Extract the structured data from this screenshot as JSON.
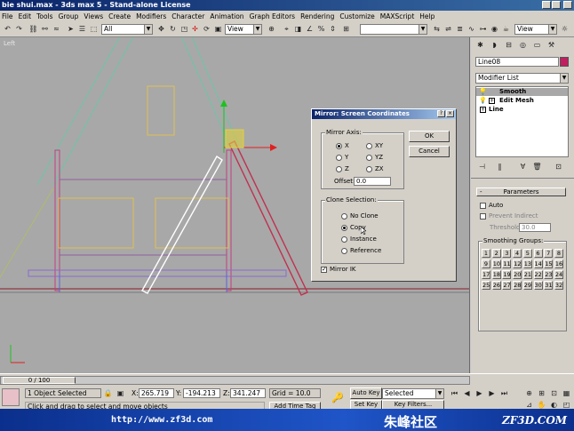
{
  "window": {
    "title": "bie shui.max - 3ds max 5 - Stand-alone License"
  },
  "menu": [
    "File",
    "Edit",
    "Tools",
    "Group",
    "Views",
    "Create",
    "Modifiers",
    "Character",
    "Animation",
    "Graph Editors",
    "Rendering",
    "Customize",
    "MAXScript",
    "Help"
  ],
  "toolbar": {
    "selection_filter": "All",
    "ref_coord": "View",
    "right_view": "View"
  },
  "viewport": {
    "label": "Left"
  },
  "command_panel": {
    "object_name": "Line08",
    "modifier_list": "Modifier List",
    "stack": [
      "Smooth",
      "Edit Mesh",
      "Line"
    ],
    "rollout_title": "Parameters",
    "auto_label": "Auto",
    "prevent_label": "Prevent Indirect",
    "threshold_label": "Threshold",
    "threshold_value": "30.0",
    "smoothing_title": "Smoothing Groups:",
    "groups": [
      "1",
      "2",
      "3",
      "4",
      "5",
      "6",
      "7",
      "8",
      "9",
      "10",
      "11",
      "12",
      "13",
      "14",
      "15",
      "16",
      "17",
      "18",
      "19",
      "20",
      "21",
      "22",
      "23",
      "24",
      "25",
      "26",
      "27",
      "28",
      "29",
      "30",
      "31",
      "32"
    ]
  },
  "dialog": {
    "title": "Mirror: Screen Coordinates",
    "axis_title": "Mirror Axis:",
    "axes": {
      "x": "X",
      "y": "Y",
      "z": "Z",
      "xy": "XY",
      "yz": "YZ",
      "zx": "ZX"
    },
    "offset_label": "Offset:",
    "offset_value": "0.0",
    "clone_title": "Clone Selection:",
    "clone_options": {
      "no_clone": "No Clone",
      "copy": "Copy",
      "instance": "Instance",
      "reference": "Reference"
    },
    "mirror_ik": "Mirror IK",
    "ok": "OK",
    "cancel": "Cancel"
  },
  "status": {
    "frame": "0 / 100",
    "selected": "1 Object Selected",
    "x_label": "X:",
    "x": "265.719",
    "y_label": "Y:",
    "y": "-194.213",
    "z_label": "Z:",
    "z": "341.247",
    "grid": "Grid = 10.0",
    "auto_key": "Auto Key",
    "set_key": "Set Key",
    "selected_combo": "Selected",
    "key_filters": "Key Filters...",
    "prompt": "Click and drag to select and move objects",
    "add_time_tag": "Add Time Tag"
  },
  "footer": {
    "url": "http://www.zf3d.com",
    "brand_cn": "朱峰社区",
    "brand_en": "ZF3D.COM"
  }
}
